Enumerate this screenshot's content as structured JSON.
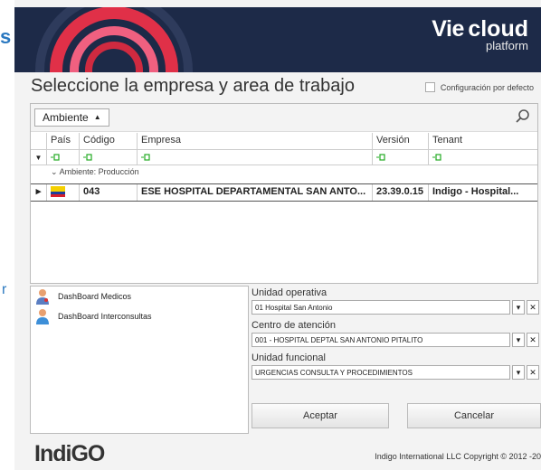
{
  "left_partial": {
    "ch1": "s",
    "ch2": "r"
  },
  "header": {
    "brand_prefix": "Vie",
    "brand_word": "cloud",
    "brand_sub": "platform"
  },
  "title": "Seleccione la empresa y area de trabajo",
  "config_default": "Configuración por defecto",
  "toolbar": {
    "ambiente": "Ambiente",
    "caret": "▲"
  },
  "columns": {
    "pais": "País",
    "codigo": "Código",
    "empresa": "Empresa",
    "version": "Versión",
    "tenant": "Tenant"
  },
  "group": {
    "label": "Ambiente: Producción"
  },
  "row": {
    "pointer": "▸",
    "codigo": "043",
    "empresa": "ESE HOSPITAL DEPARTAMENTAL SAN ANTO...",
    "version": "23.39.0.15",
    "tenant": "Indigo - Hospital..."
  },
  "dashboards": [
    {
      "label": "DashBoard Medicos"
    },
    {
      "label": "DashBoard Interconsultas"
    }
  ],
  "form": {
    "unidad_operativa": {
      "label": "Unidad operativa",
      "value": "01 Hospital San Antonio"
    },
    "centro": {
      "label": "Centro de atención",
      "value": "001 - HOSPITAL DEPTAL SAN ANTONIO PITALITO"
    },
    "funcional": {
      "label": "Unidad funcional",
      "value": "URGENCIAS CONSULTA Y PROCEDIMIENTOS"
    },
    "dropdown_glyph": "▾",
    "clear_glyph": "✕"
  },
  "buttons": {
    "accept": "Aceptar",
    "cancel": "Cancelar"
  },
  "logo": {
    "part1": "Indi",
    "part2": "GO"
  },
  "copyright": "Indigo International LLC Copyright © 2012 -20",
  "colors": {
    "header_bg": "#1d2a48",
    "arc_red": "#e03048",
    "arc_pink": "#f06080",
    "accent_blue": "#2a78c0"
  }
}
